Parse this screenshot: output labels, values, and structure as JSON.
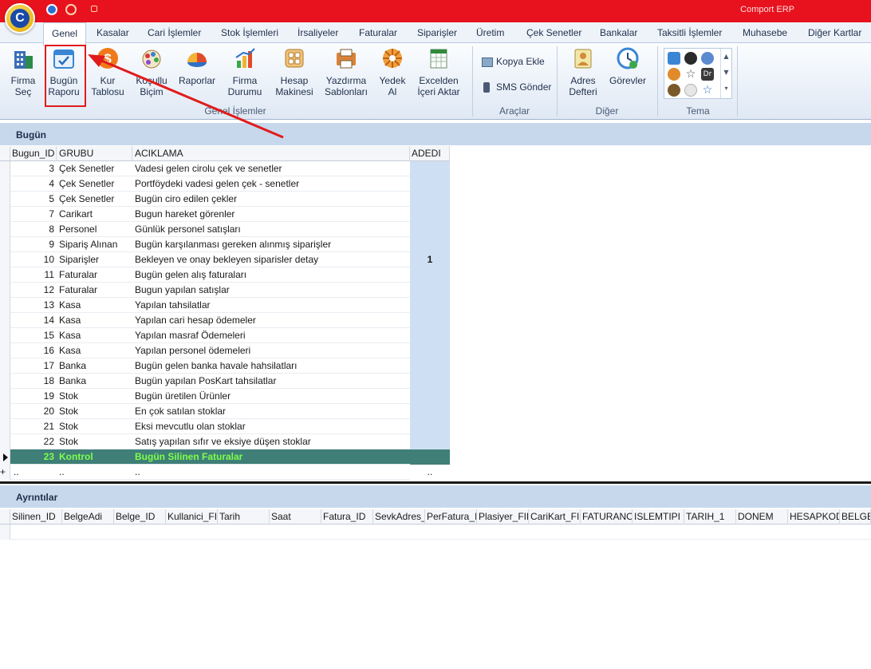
{
  "window": {
    "title": "Comport ERP"
  },
  "tabs": [
    "Genel",
    "Kasalar",
    "Cari İşlemler",
    "Stok İşlemleri",
    "İrsaliyeler",
    "Faturalar",
    "Siparişler",
    "Üretim",
    "Çek Senetler",
    "Bankalar",
    "Taksitli İşlemler",
    "Muhasebe",
    "Diğer Kartlar"
  ],
  "ribbon": {
    "genel_islemler": {
      "label": "Genel İşlemler",
      "buttons": [
        {
          "l1": "Firma",
          "l2": "Seç"
        },
        {
          "l1": "Bugün",
          "l2": "Raporu"
        },
        {
          "l1": "Kur",
          "l2": "Tablosu"
        },
        {
          "l1": "Koşullu",
          "l2": "Biçim"
        },
        {
          "l1": "Raporlar",
          "l2": ""
        },
        {
          "l1": "Firma",
          "l2": "Durumu"
        },
        {
          "l1": "Hesap",
          "l2": "Makinesi"
        },
        {
          "l1": "Yazdırma",
          "l2": "Sablonları"
        },
        {
          "l1": "Yedek",
          "l2": "Al"
        },
        {
          "l1": "Excelden",
          "l2": "İçeri Aktar"
        }
      ]
    },
    "araclar": {
      "label": "Araçlar",
      "kopya": "Kopya Ekle",
      "sms": "SMS Gönder"
    },
    "diger": {
      "label": "Diğer",
      "adres1": "Adres",
      "adres2": "Defteri",
      "gorevler": "Görevler"
    },
    "tema": {
      "label": "Tema",
      "dr": "Dr"
    }
  },
  "bugun": {
    "header": "Bugün",
    "columns": [
      "Bugun_ID",
      "GRUBU",
      "ACIKLAMA",
      "ADEDI"
    ],
    "rows": [
      {
        "id": "3",
        "grup": "Çek Senetler",
        "aciklama": "Vadesi gelen cirolu çek ve senetler",
        "adedi": ""
      },
      {
        "id": "4",
        "grup": "Çek Senetler",
        "aciklama": "Portföydeki vadesi gelen çek - senetler",
        "adedi": ""
      },
      {
        "id": "5",
        "grup": "Çek Senetler",
        "aciklama": "Bugün ciro edilen çekler",
        "adedi": ""
      },
      {
        "id": "7",
        "grup": "Carikart",
        "aciklama": "Bugun hareket görenler",
        "adedi": ""
      },
      {
        "id": "8",
        "grup": "Personel",
        "aciklama": "Günlük personel satışları",
        "adedi": ""
      },
      {
        "id": "9",
        "grup": "Sipariş Alınan",
        "aciklama": "Bugün karşılanması gereken alınmış siparişler",
        "adedi": ""
      },
      {
        "id": "10",
        "grup": "Siparişler",
        "aciklama": "Bekleyen ve onay bekleyen siparisler detay",
        "adedi": "1"
      },
      {
        "id": "11",
        "grup": "Faturalar",
        "aciklama": "Bugün gelen alış faturaları",
        "adedi": ""
      },
      {
        "id": "12",
        "grup": "Faturalar",
        "aciklama": "Bugun yapılan satışlar",
        "adedi": ""
      },
      {
        "id": "13",
        "grup": "Kasa",
        "aciklama": "Yapılan tahsilatlar",
        "adedi": ""
      },
      {
        "id": "14",
        "grup": "Kasa",
        "aciklama": "Yapılan cari hesap ödemeler",
        "adedi": ""
      },
      {
        "id": "15",
        "grup": "Kasa",
        "aciklama": "Yapılan masraf Ödemeleri",
        "adedi": ""
      },
      {
        "id": "16",
        "grup": "Kasa",
        "aciklama": "Yapılan personel ödemeleri",
        "adedi": ""
      },
      {
        "id": "17",
        "grup": "Banka",
        "aciklama": "Bugün gelen banka havale hahsilatları",
        "adedi": ""
      },
      {
        "id": "18",
        "grup": "Banka",
        "aciklama": "Bugün yapılan PosKart tahsilatlar",
        "adedi": ""
      },
      {
        "id": "19",
        "grup": "Stok",
        "aciklama": "Bugün üretilen Ürünler",
        "adedi": ""
      },
      {
        "id": "20",
        "grup": "Stok",
        "aciklama": "En çok satılan stoklar",
        "adedi": ""
      },
      {
        "id": "21",
        "grup": "Stok",
        "aciklama": "Eksi mevcutlu olan stoklar",
        "adedi": ""
      },
      {
        "id": "22",
        "grup": "Stok",
        "aciklama": "Satış yapılan sıfır ve eksiye düşen stoklar",
        "adedi": ""
      },
      {
        "id": "23",
        "grup": "Kontrol",
        "aciklama": "Bugün Silinen Faturalar",
        "adedi": ""
      }
    ],
    "new_row": {
      "sel": "+",
      "id": "..",
      "grup": "..",
      "aciklama": "..",
      "adedi": ".."
    }
  },
  "ayrintilar": {
    "header": "Ayrıntılar",
    "columns": [
      "Silinen_ID",
      "BelgeAdi",
      "Belge_ID",
      "Kullanici_FII",
      "Tarih",
      "Saat",
      "Fatura_ID",
      "SevkAdres_",
      "PerFatura_I",
      "Plasiyer_FID",
      "CariKart_FII",
      "FATURANO",
      "ISLEMTIPI",
      "TARIH_1",
      "DONEM",
      "HESAPKOD",
      "BELGEKOD"
    ]
  },
  "colors": {
    "accent": "#e8121f",
    "selected_row": "#3f7f78",
    "selected_text": "#7dff4a",
    "header": "#c7d8ec"
  }
}
